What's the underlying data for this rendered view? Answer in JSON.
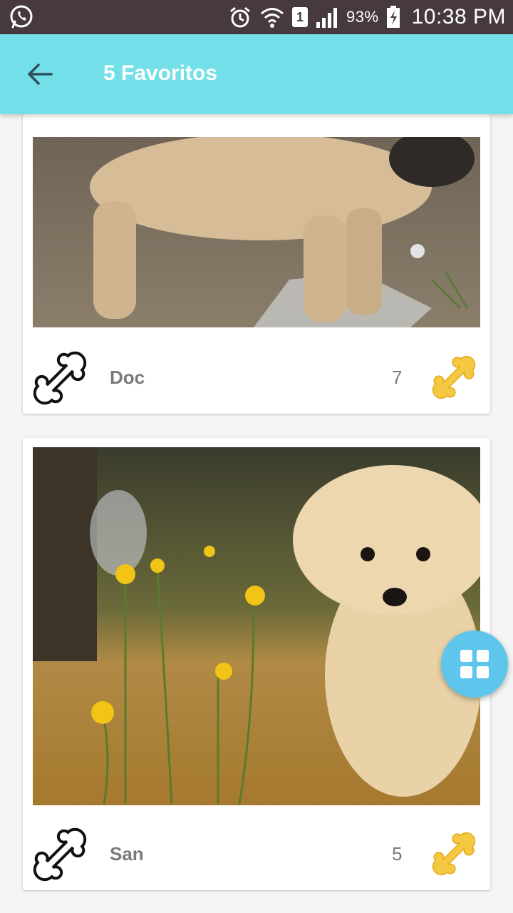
{
  "status_bar": {
    "icons": [
      "whatsapp-icon",
      "alarm-icon",
      "wifi-icon",
      "sim-icon",
      "signal-icon",
      "battery-icon"
    ],
    "sim_label": "1",
    "battery": "93%",
    "time": "10:38 PM"
  },
  "app_bar": {
    "title": "5 Favoritos",
    "background": "#73dfe9"
  },
  "favorites": [
    {
      "name": "Doc",
      "likes": "7",
      "photo": "shar-pei-puppy-photo"
    },
    {
      "name": "San",
      "likes": "5",
      "photo": "fluffy-puppy-photo"
    }
  ],
  "fab": {
    "icon": "grid-icon",
    "color": "#5ec6ec"
  },
  "colors": {
    "bone_filled": "#f5c842",
    "text_gray": "#7a7a7a"
  }
}
